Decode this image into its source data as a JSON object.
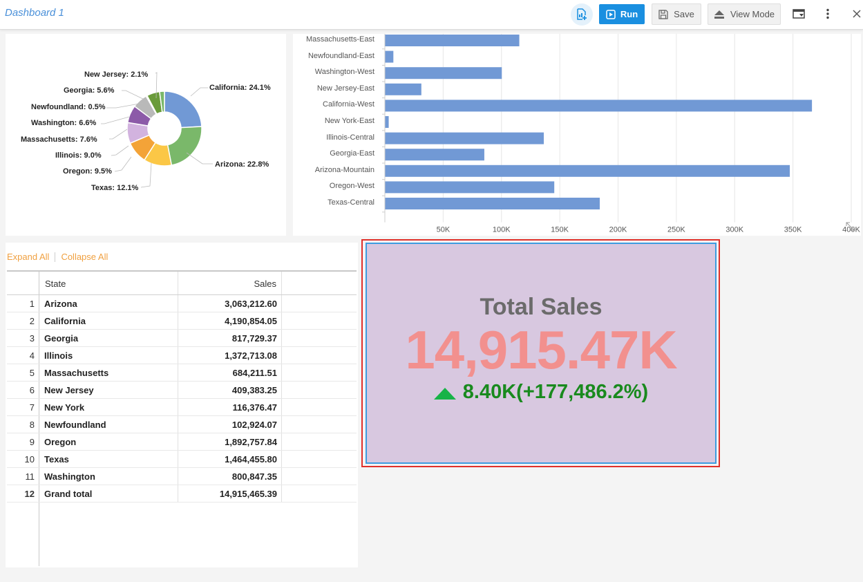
{
  "header": {
    "title": "Dashboard 1",
    "run_label": "Run",
    "save_label": "Save",
    "view_mode_label": "View Mode"
  },
  "colors": {
    "accent": "#1a8fe0",
    "bar": "#7199d5",
    "kpi_background": "#d8c8e0",
    "kpi_value": "#f2908e",
    "kpi_delta": "#198a1e",
    "links": "#f0a040"
  },
  "pie_chart": {
    "type": "pie",
    "labels": [
      "California: 24.1%",
      "Arizona: 22.8%",
      "Texas: 12.1%",
      "Oregon: 9.5%",
      "Illinois: 9.0%",
      "Massachusetts: 7.6%",
      "Washington: 6.6%",
      "Newfoundland: 0.5%",
      "Georgia: 5.6%",
      "New Jersey: 2.1%"
    ]
  },
  "chart_data": {
    "type": "bar",
    "orientation": "horizontal",
    "categories": [
      "Massachusetts-East",
      "Newfoundland-East",
      "Washington-West",
      "New Jersey-East",
      "California-West",
      "New York-East",
      "Illinois-Central",
      "Georgia-East",
      "Arizona-Mountain",
      "Oregon-West",
      "Texas-Central"
    ],
    "values": [
      115000,
      7000,
      100000,
      31000,
      366000,
      3000,
      136000,
      85000,
      347000,
      145000,
      184000
    ],
    "xlim": [
      0,
      400000
    ],
    "xticks": [
      "50K",
      "100K",
      "150K",
      "200K",
      "250K",
      "300K",
      "350K",
      "400K"
    ],
    "grid": true,
    "color": "#7199d5"
  },
  "table": {
    "expand_all": "Expand All",
    "collapse_all": "Collapse All",
    "columns": [
      "State",
      "Sales"
    ],
    "rows": [
      {
        "num": "1",
        "state": "Arizona",
        "sales": "3,063,212.60"
      },
      {
        "num": "2",
        "state": "California",
        "sales": "4,190,854.05"
      },
      {
        "num": "3",
        "state": "Georgia",
        "sales": "817,729.37"
      },
      {
        "num": "4",
        "state": "Illinois",
        "sales": "1,372,713.08"
      },
      {
        "num": "5",
        "state": "Massachusetts",
        "sales": "684,211.51"
      },
      {
        "num": "6",
        "state": "New Jersey",
        "sales": "409,383.25"
      },
      {
        "num": "7",
        "state": "New York",
        "sales": "116,376.47"
      },
      {
        "num": "8",
        "state": "Newfoundland",
        "sales": "102,924.07"
      },
      {
        "num": "9",
        "state": "Oregon",
        "sales": "1,892,757.84"
      },
      {
        "num": "10",
        "state": "Texas",
        "sales": "1,464,455.80"
      },
      {
        "num": "11",
        "state": "Washington",
        "sales": "800,847.35"
      },
      {
        "num": "12",
        "state": "Grand total",
        "sales": "14,915,465.39"
      }
    ]
  },
  "kpi": {
    "title": "Total Sales",
    "value": "14,915.47K",
    "delta": "8.40K(+177,486.2%)",
    "delta_icon": "triangle-up-icon"
  }
}
